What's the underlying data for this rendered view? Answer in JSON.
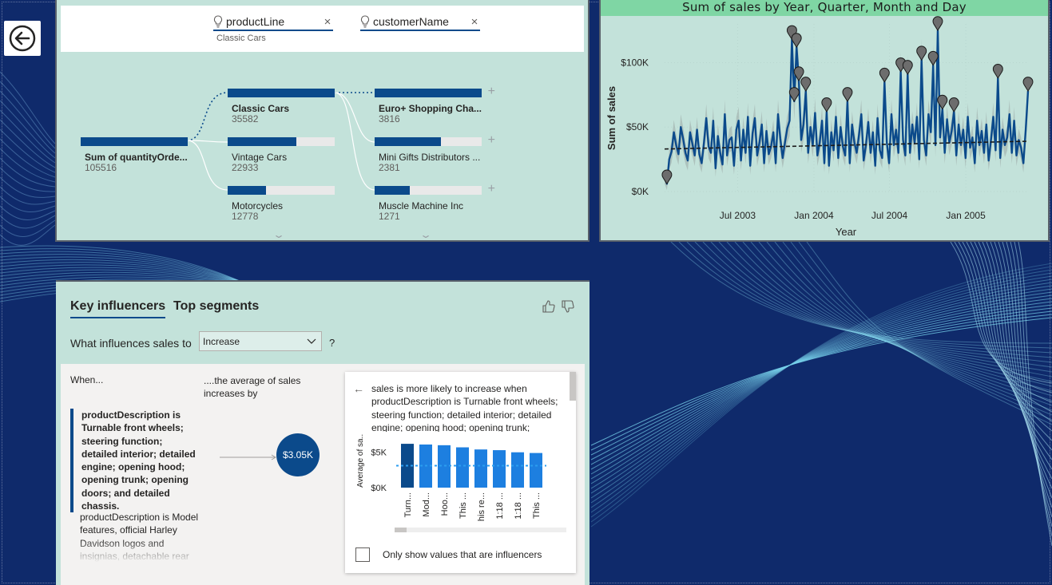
{
  "theme": {
    "accent": "#0b4a8b",
    "panel_bg": "#c3e2da",
    "title_bar": "#7fd6a4",
    "page_bg": "#0f2a6b",
    "bar_light": "#1d7fe0"
  },
  "nav": {
    "back_icon": "arrow-left-circle-icon"
  },
  "decomposition_tree": {
    "levels": [
      {
        "label": "productLine",
        "selected": "Classic Cars"
      },
      {
        "label": "customerName",
        "selected": ""
      }
    ],
    "root": {
      "name": "Sum of quantityOrde...",
      "value": "105516"
    },
    "product_lines": [
      {
        "name": "Classic Cars",
        "value": "35582",
        "fraction": 1.0
      },
      {
        "name": "Vintage Cars",
        "value": "22933",
        "fraction": 0.64
      },
      {
        "name": "Motorcycles",
        "value": "12778",
        "fraction": 0.36
      }
    ],
    "customers": [
      {
        "name": "Euro+ Shopping Cha...",
        "value": "3816",
        "fraction": 1.0
      },
      {
        "name": "Mini Gifts Distributors ...",
        "value": "2381",
        "fraction": 0.62
      },
      {
        "name": "Muscle Machine Inc",
        "value": "1271",
        "fraction": 0.33
      }
    ]
  },
  "chart_data": {
    "type": "line",
    "title": "Sum of sales by Year, Quarter, Month and Day",
    "xlabel": "Year",
    "ylabel": "Sum of sales",
    "x_ticks": [
      "Jul 2003",
      "Jan 2004",
      "Jul 2004",
      "Jan 2005"
    ],
    "y_ticks": [
      "$0K",
      "$50K",
      "$100K"
    ],
    "ylim": [
      0,
      130000
    ],
    "x_range": [
      "2003-01-06",
      "2005-05-31"
    ],
    "series": [
      {
        "values": [
          12000,
          6000,
          25000,
          31000,
          46000,
          36000,
          29000,
          50000,
          41000,
          30000,
          24000,
          46000,
          37000,
          28000,
          48000,
          29000,
          22000,
          38000,
          57000,
          35000,
          30000,
          55000,
          18000,
          43000,
          30000,
          21000,
          60000,
          28000,
          40000,
          42000,
          20000,
          48000,
          55000,
          24000,
          48000,
          30000,
          58000,
          20000,
          45000,
          57000,
          28000,
          38000,
          52000,
          22000,
          47000,
          29000,
          35000,
          46000,
          22000,
          60000,
          41000,
          26000,
          38000,
          49000,
          55000,
          118000,
          70000,
          112000,
          86000,
          40000,
          52000,
          78000,
          30000,
          50000,
          36000,
          61000,
          28000,
          38000,
          55000,
          22000,
          62000,
          20000,
          46000,
          32000,
          58000,
          26000,
          50000,
          35000,
          28000,
          70000,
          22000,
          52000,
          38000,
          30000,
          44000,
          60000,
          24000,
          36000,
          54000,
          30000,
          46000,
          20000,
          57000,
          32000,
          26000,
          85000,
          38000,
          22000,
          60000,
          36000,
          48000,
          30000,
          93000,
          40000,
          28000,
          91000,
          30000,
          52000,
          38000,
          58000,
          25000,
          102000,
          40000,
          28000,
          60000,
          46000,
          98000,
          36000,
          125000,
          42000,
          64000,
          30000,
          56000,
          38000,
          47000,
          62000,
          28000,
          52000,
          36000,
          48000,
          26000,
          58000,
          34000,
          42000,
          22000,
          55000,
          36000,
          47000,
          30000,
          52000,
          24000,
          40000,
          58000,
          32000,
          88000,
          26000,
          48000,
          36000,
          42000,
          60000,
          30000,
          55000,
          28000,
          40000,
          34000,
          22000,
          48000,
          78000
        ],
        "reference_line": {
          "type": "trend",
          "style": "dashed"
        },
        "anomalies": 18
      }
    ]
  },
  "key_influencers": {
    "tabs": [
      "Key influencers",
      "Top segments"
    ],
    "active_tab": 0,
    "question": "What influences sales to",
    "direction": "Increase",
    "question_mark": "?",
    "col_when": "When...",
    "col_avg": "....the average of sales increases by",
    "influencer_1": "productDescription is Turnable front wheels; steering function; detailed interior; detailed engine; opening hood; opening trunk; opening doors; and detailed chassis.",
    "influencer_2": "productDescription is Model features, official Harley Davidson logos and insignias, detachable rear",
    "bubble_value": "$3.05K",
    "detail_text": "sales is more likely to increase when productDescription is Turnable front wheels; steering function; detailed interior; detailed engine; opening hood; opening trunk;",
    "detail_chart": {
      "type": "bar",
      "ylabel": "Average of sa...",
      "y_ticks": [
        "$0K",
        "$5K"
      ],
      "ylim": [
        0,
        7000
      ],
      "average_line": 3100,
      "categories": [
        "Turn...",
        "Mod...",
        "Hoo...",
        "This ...",
        "his re...",
        "1:18 ...",
        "1:18 ...",
        "This ..."
      ],
      "values": [
        6200,
        6100,
        6000,
        5700,
        5400,
        5300,
        5000,
        4900
      ],
      "highlight_index": 0
    },
    "checkbox_label": "Only show values that are influencers"
  }
}
